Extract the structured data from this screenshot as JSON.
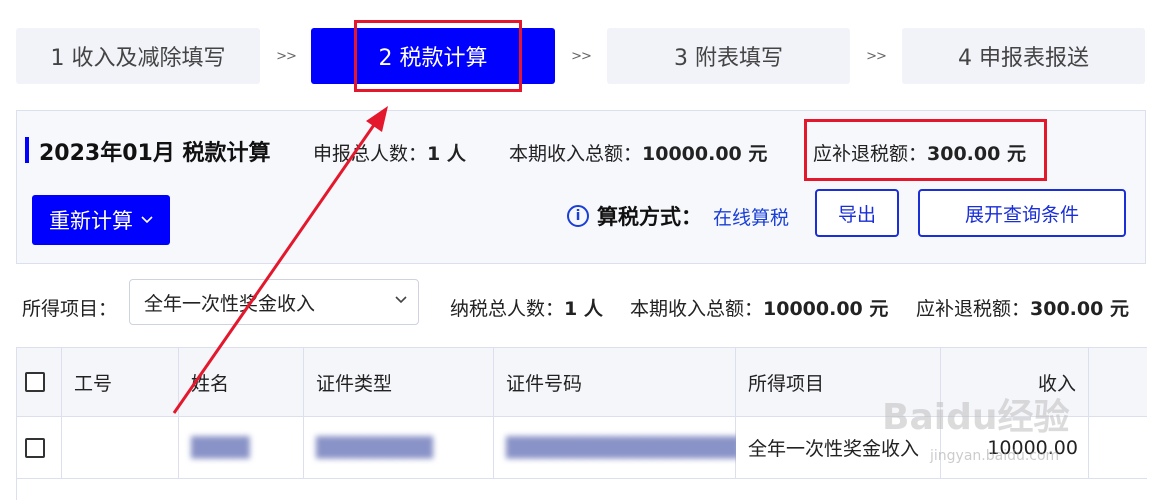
{
  "steps": [
    {
      "label": "1 收入及减除填写"
    },
    {
      "label": "2 税款计算"
    },
    {
      "label": "3 附表填写"
    },
    {
      "label": "4 申报表报送"
    }
  ],
  "step_separator": ">>",
  "summary": {
    "title": "2023年01月  税款计算",
    "declare_count_label": "申报总人数：",
    "declare_count_value": "1 人",
    "income_total_label": "本期收入总额：",
    "income_total_value": "10000.00 元",
    "tax_due_label": "应补退税额：",
    "tax_due_value": "300.00 元",
    "recalc_button": "重新计算",
    "method_label": "算税方式：",
    "method_value": "在线算税",
    "export_button": "导出",
    "expand_button": "展开查询条件"
  },
  "filter": {
    "label": "所得项目：",
    "selected": "全年一次性奖金收入",
    "taxpayer_count_label": "纳税总人数：",
    "taxpayer_count_value": "1 人",
    "income_total_label": "本期收入总额：",
    "income_total_value": "10000.00 元",
    "tax_due_label": "应补退税额：",
    "tax_due_value": "300.00 元"
  },
  "table": {
    "headers": [
      "工号",
      "姓名",
      "证件类型",
      "证件号码",
      "所得项目",
      "收入"
    ],
    "rows": [
      {
        "employee_id": "",
        "name": "████",
        "id_type": "████████",
        "id_number": "████████████████",
        "income_item": "全年一次性奖金收入",
        "income": "10000.00"
      }
    ]
  },
  "watermark": {
    "main": "Baidu经验",
    "sub": "jingyan.baidu.com"
  },
  "colors": {
    "primary": "#0000ff",
    "link": "#1a3fd6",
    "annotation": "#e3182d"
  }
}
